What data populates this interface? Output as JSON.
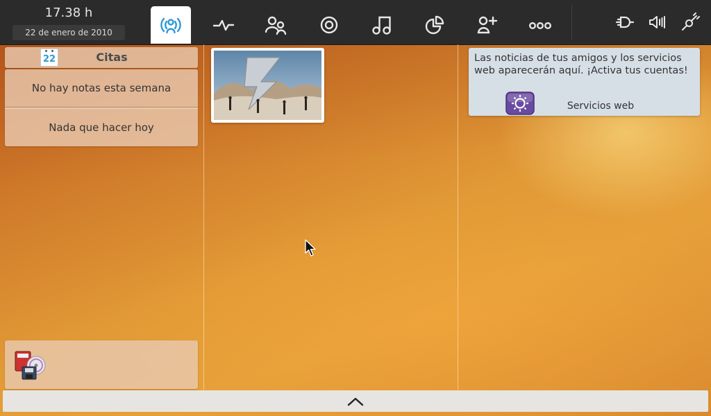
{
  "clock": {
    "time": "17.38 h",
    "date": "22 de enero de 2010"
  },
  "toolbar": {
    "tabs": [
      {
        "name": "myzone",
        "icon": "broadcast-person-icon",
        "active": true
      },
      {
        "name": "status",
        "icon": "pulse-icon",
        "active": false
      },
      {
        "name": "people",
        "icon": "people-icon",
        "active": false
      },
      {
        "name": "internet",
        "icon": "target-icon",
        "active": false
      },
      {
        "name": "media",
        "icon": "music-note-icon",
        "active": false
      },
      {
        "name": "pasteboard",
        "icon": "pie-chart-icon",
        "active": false
      },
      {
        "name": "applications",
        "icon": "add-person-icon",
        "active": false
      },
      {
        "name": "zones",
        "icon": "three-circles-icon",
        "active": false
      }
    ],
    "tray": [
      {
        "name": "power",
        "icon": "plug-icon"
      },
      {
        "name": "volume",
        "icon": "volume-icon"
      },
      {
        "name": "network",
        "icon": "connection-icon"
      }
    ]
  },
  "appointments": {
    "title": "Citas",
    "calendar_day": "22",
    "no_notes": "No hay notas esta semana",
    "nothing_todo": "Nada que hacer hoy"
  },
  "web_services": {
    "message": "Las noticias de tus amigos y los servicios web aparecerán aquí. ¡Activa tus cuentas!",
    "button_label": "Servicios web"
  },
  "colors": {
    "accent_active": "#2d9ad6",
    "topbar": "#2b2b2b",
    "web_icon": "#6a4aa0"
  }
}
